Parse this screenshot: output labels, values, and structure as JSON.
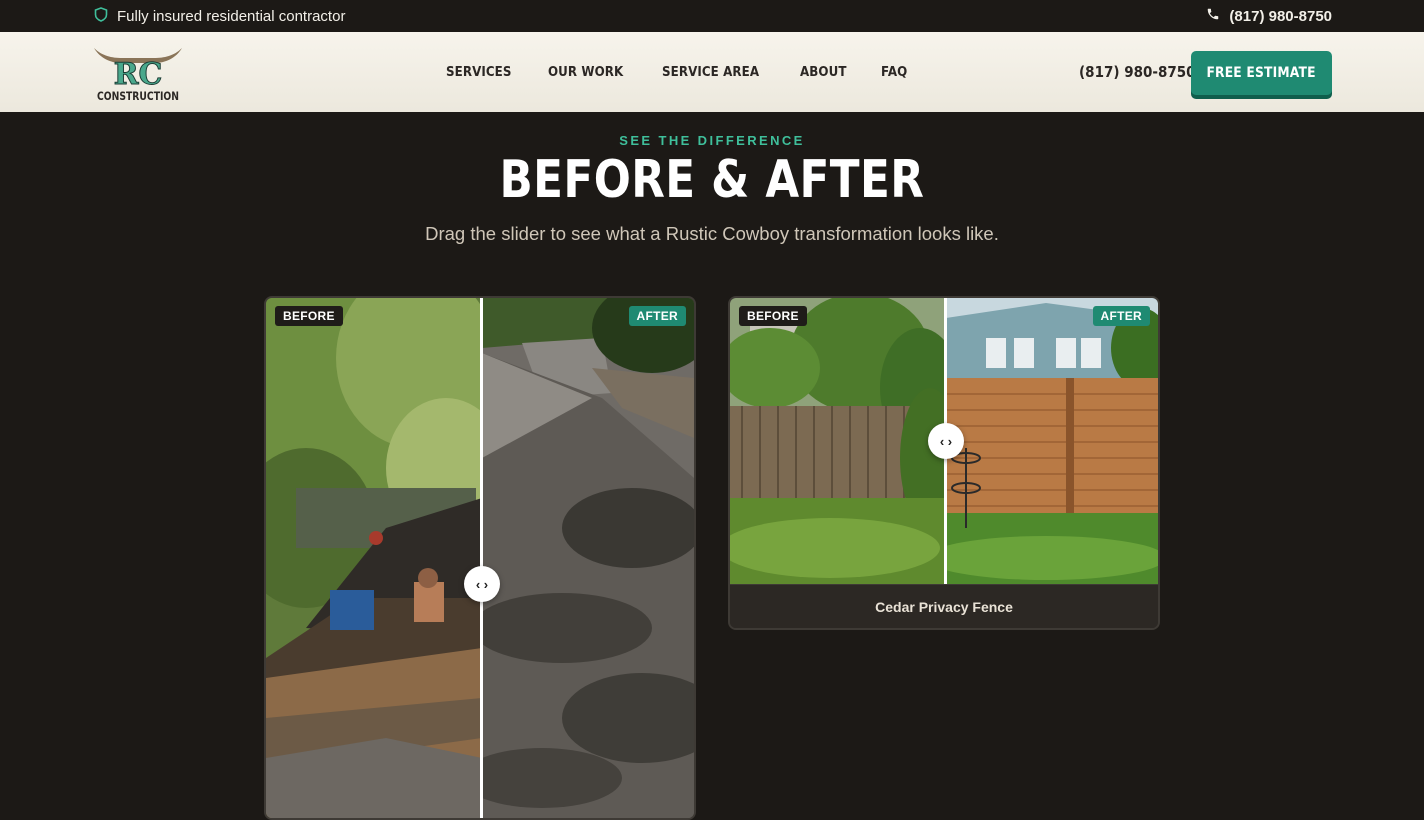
{
  "topbar": {
    "insured_text": "Fully insured residential contractor",
    "phone": "(817) 980-8750"
  },
  "header": {
    "logo_text_top": "RC",
    "logo_text_bottom": "CONSTRUCTION",
    "nav": [
      {
        "label": "SERVICES"
      },
      {
        "label": "OUR WORK"
      },
      {
        "label": "SERVICE AREA"
      },
      {
        "label": "ABOUT"
      },
      {
        "label": "FAQ"
      }
    ],
    "phone": "(817) 980-8750",
    "cta_label": "FREE ESTIMATE"
  },
  "hero": {
    "eyebrow": "SEE THE DIFFERENCE",
    "title": "BEFORE & AFTER",
    "subtitle": "Drag the slider to see what a Rustic Cowboy transformation looks like."
  },
  "comparisons": [
    {
      "before_label": "BEFORE",
      "after_label": "AFTER",
      "slider_position": 0.5,
      "caption": ""
    },
    {
      "before_label": "BEFORE",
      "after_label": "AFTER",
      "slider_position": 0.5,
      "caption": "Cedar Privacy Fence"
    }
  ],
  "colors": {
    "background": "#1c1916",
    "accent": "#1f8a72",
    "eyebrow": "#3fbf9b",
    "header_bg": "#f4f1e9"
  },
  "icons": {
    "insured": "shield-icon",
    "phone": "phone-icon",
    "slider_handle": "chevron-left-right-icon"
  }
}
